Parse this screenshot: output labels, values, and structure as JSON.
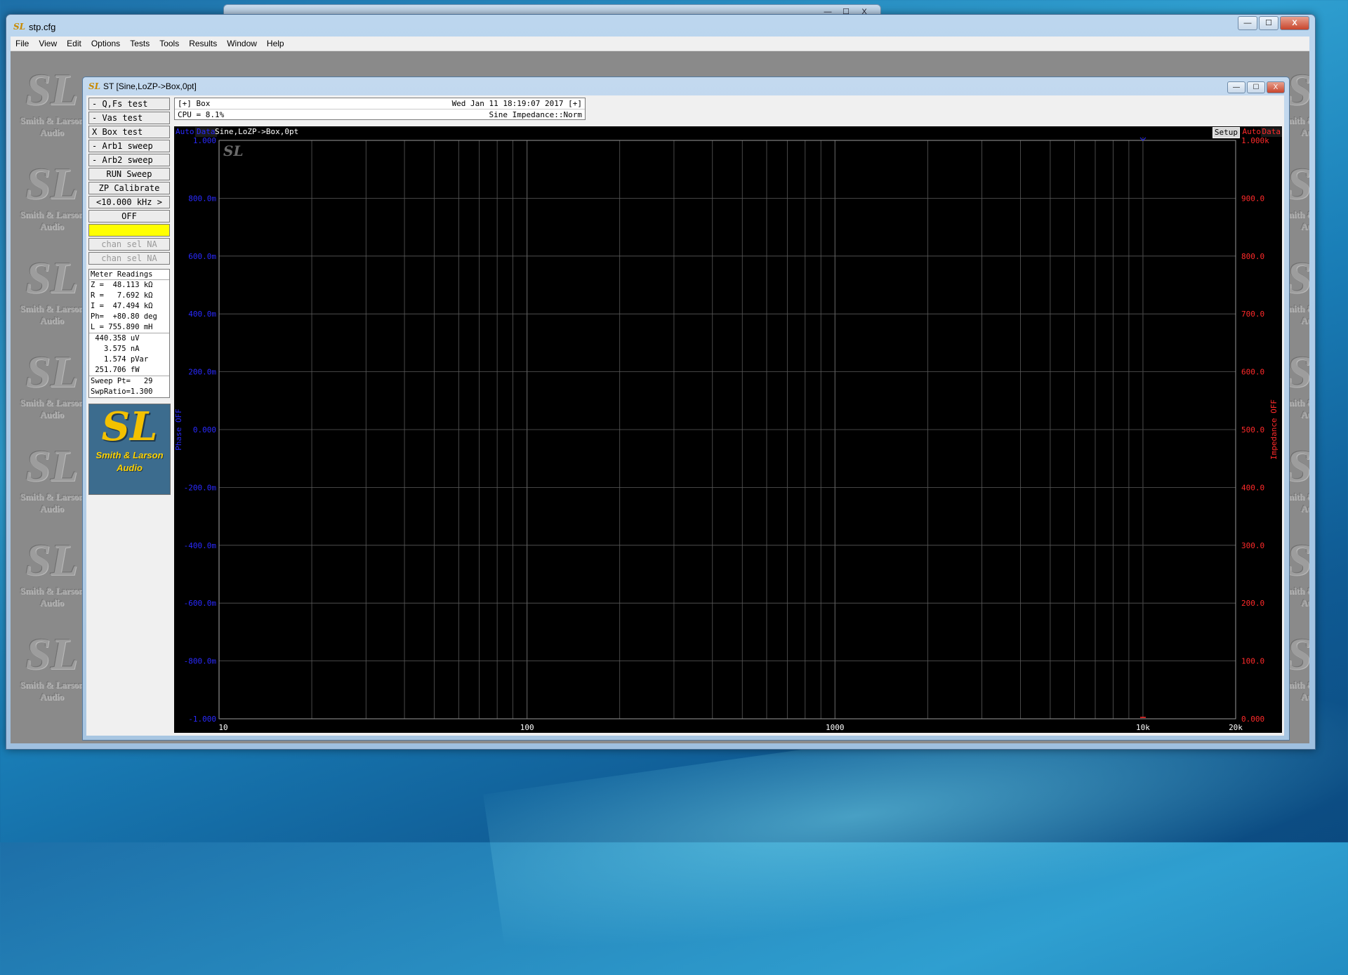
{
  "desktop": {
    "bg_window_controls": [
      "—",
      "☐",
      "X"
    ]
  },
  "app": {
    "title": "stp.cfg",
    "menu": [
      "File",
      "View",
      "Edit",
      "Options",
      "Tests",
      "Tools",
      "Results",
      "Window",
      "Help"
    ],
    "window_controls": [
      "—",
      "☐",
      "X"
    ]
  },
  "watermark": {
    "mark": "SL",
    "lines": [
      "Smith & Larson",
      "Audio"
    ]
  },
  "child_window": {
    "title": "ST [Sine,LoZP->Box,0pt]",
    "controls": [
      "—",
      "☐",
      "X"
    ]
  },
  "left_panel": {
    "buttons": [
      {
        "label": "- Q,Fs test",
        "style": "normal"
      },
      {
        "label": "- Vas test",
        "style": "normal"
      },
      {
        "label": "X Box test",
        "style": "normal"
      },
      {
        "label": "- Arb1 sweep",
        "style": "normal"
      },
      {
        "label": "- Arb2 sweep",
        "style": "normal"
      },
      {
        "label": "RUN Sweep",
        "style": "center"
      },
      {
        "label": "ZP Calibrate",
        "style": "center"
      },
      {
        "label": "<10.000 kHz >",
        "style": "center"
      },
      {
        "label": "OFF",
        "style": "center"
      },
      {
        "label": "",
        "style": "yellow"
      },
      {
        "label": "chan sel NA",
        "style": "disabled"
      },
      {
        "label": "chan sel NA",
        "style": "disabled"
      }
    ],
    "meter_title": "Meter Readings",
    "meter_lines_a": [
      "Z =  48.113 kΩ",
      "R =   7.692 kΩ",
      "I =  47.494 kΩ",
      "Ph=  +80.80 deg",
      "L = 755.890 mH"
    ],
    "meter_lines_b": [
      " 440.358 uV",
      "   3.575 nA",
      "   1.574 pVar",
      " 251.706 fW"
    ],
    "meter_lines_c": [
      "Sweep Pt=   29",
      "SwpRatio=1.300"
    ],
    "brand": {
      "mark": "SL",
      "line1": "Smith & Larson",
      "line2": "Audio"
    }
  },
  "status": {
    "row1_left": "[+] Box",
    "row1_right": "Wed Jan 11 18:19:07 2017 [+]",
    "row2_left": "CPU = 8.1%",
    "row2_right": "Sine Impedance::Norm"
  },
  "graph": {
    "left_tags": [
      "Auto",
      "Data"
    ],
    "trace_name": "Sine,LoZP->Box,0pt",
    "setup_label": "Setup",
    "right_tags": [
      "Auto",
      "Data"
    ],
    "left_axis_label": "Phase OFF",
    "right_axis_label": "Impedance OFF",
    "colors": {
      "left_axis": "#2a2aff",
      "right_axis": "#ff2a2a",
      "grid": "#5a5a5a",
      "plot_bg": "#000000",
      "label": "#ffffff"
    }
  },
  "chart_data": {
    "type": "line",
    "title": "",
    "x_scale": "log",
    "xlim": [
      10,
      20000
    ],
    "x_ticks": [
      {
        "v": 10,
        "label": "10"
      },
      {
        "v": 100,
        "label": "100"
      },
      {
        "v": 1000,
        "label": "1000"
      },
      {
        "v": 10000,
        "label": "10k"
      },
      {
        "v": 20000,
        "label": "20k"
      }
    ],
    "y_left": {
      "label": "Phase OFF",
      "lim": [
        -1,
        1
      ],
      "ticks": [
        "1.000",
        "800.0m",
        "600.0m",
        "400.0m",
        "200.0m",
        "0.000",
        "-200.0m",
        "-400.0m",
        "-600.0m",
        "-800.0m",
        "-1.000"
      ]
    },
    "y_right": {
      "label": "Impedance OFF",
      "lim": [
        0,
        1000
      ],
      "ticks": [
        "1.000k",
        "900.0",
        "800.0",
        "700.0",
        "600.0",
        "500.0",
        "400.0",
        "300.0",
        "200.0",
        "100.0",
        "0.000"
      ]
    },
    "marker_x": 10000,
    "grid": true,
    "series": []
  }
}
